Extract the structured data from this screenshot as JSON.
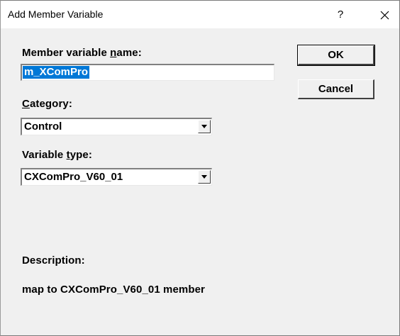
{
  "window": {
    "title": "Add Member Variable",
    "help_glyph": "?",
    "close_icon": "close-icon"
  },
  "form": {
    "name_label_pre": "Member variable ",
    "name_label_underlined": "n",
    "name_label_post": "ame:",
    "name_value": "m_XComPro",
    "category_label_underlined": "C",
    "category_label_post": "ategory:",
    "category_value": "Control",
    "vartype_label_pre": "Variable ",
    "vartype_label_underlined": "t",
    "vartype_label_post": "ype:",
    "vartype_value": "CXComPro_V60_01",
    "description_label": "Description:",
    "description_text": "map to CXComPro_V60_01 member"
  },
  "buttons": {
    "ok_label": "OK",
    "cancel_label": "Cancel"
  }
}
